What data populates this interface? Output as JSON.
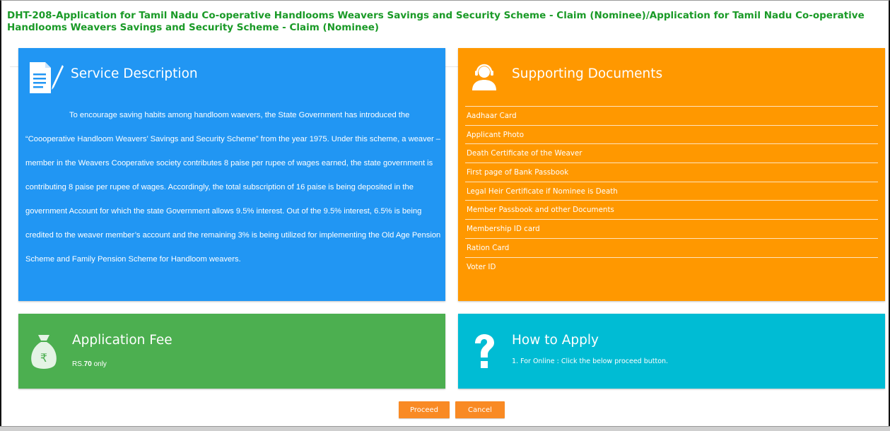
{
  "page": {
    "title": "DHT-208-Application for Tamil Nadu Co-operative Handlooms Weavers Savings and Security Scheme - Claim (Nominee)/Application for Tamil Nadu Co-operative Handlooms Weavers Savings and Security Scheme - Claim (Nominee)"
  },
  "service_description": {
    "heading": "Service Description",
    "icon": "document-edit-icon",
    "text": "To encourage saving habits among handloom waevers, the State Government has introduced the “Coooperative Handloom Weavers’ Savings and Security Scheme” from the year 1975. Under this scheme, a weaver – member in the Weavers Cooperative society contributes 8 paise per rupee of wages earned, the state government is contributing 8 paise per rupee of wages. Accordingly, the total subscription of 16 paise is being deposited in the government Account for which the state Government allows 9.5% interest. Out of the 9.5% interest, 6.5% is being credited to the weaver member’s account and the remaining 3% is being utilized for implementing the Old Age Pension Scheme and Family Pension Scheme for Handloom weavers.",
    "color": "#2196f3"
  },
  "supporting_documents": {
    "heading": "Supporting Documents",
    "icon": "support-agent-icon",
    "color": "#ff9800",
    "items": [
      "Aadhaar Card",
      "Applicant Photo",
      "Death Certificate of the Weaver",
      "First page of Bank Passbook",
      "Legal Heir Certificate if Nominee is Death",
      "Member Passbook and other Documents",
      "Membership ID card",
      "Ration Card",
      "Voter ID"
    ]
  },
  "application_fee": {
    "heading": "Application Fee",
    "icon": "rupee-money-bag-icon",
    "color": "#4caf50",
    "prefix": "RS.",
    "amount": "70",
    "suffix": " only"
  },
  "how_to_apply": {
    "heading": "How to Apply",
    "icon": "question-mark-icon",
    "color": "#00bcd4",
    "text": "1. For Online : Click the below proceed button."
  },
  "actions": {
    "proceed_label": "Proceed",
    "cancel_label": "Cancel",
    "button_color": "#f98a24"
  }
}
